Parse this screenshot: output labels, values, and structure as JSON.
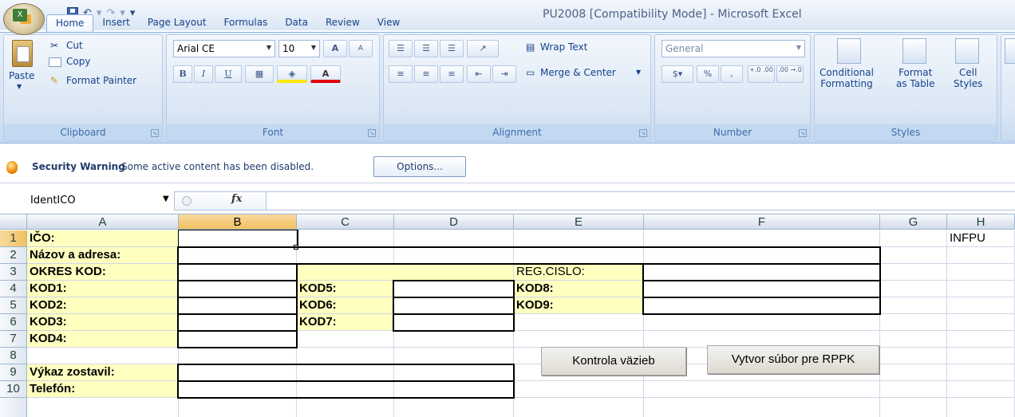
{
  "window": {
    "title": "PU2008  [Compatibility Mode] - Microsoft Excel"
  },
  "quick_access": {
    "undo": "↶",
    "redo": "↷",
    "more": "▾"
  },
  "tabs": [
    "Home",
    "Insert",
    "Page Layout",
    "Formulas",
    "Data",
    "Review",
    "View"
  ],
  "ribbon": {
    "clipboard": {
      "label": "Clipboard",
      "paste": "Paste",
      "cut": "Cut",
      "copy": "Copy",
      "format_painter": "Format Painter"
    },
    "font": {
      "label": "Font",
      "font_name": "Arial CE",
      "font_size": "10",
      "bold": "B",
      "italic": "I",
      "underline": "U",
      "grow": "A",
      "shrink": "A"
    },
    "alignment": {
      "label": "Alignment",
      "wrap_text": "Wrap Text",
      "merge_center": "Merge & Center"
    },
    "number": {
      "label": "Number",
      "format": "General",
      "percent": "%",
      "comma": ",",
      "inc_decimal": "+.0 .00",
      "dec_decimal": ".00 →.0"
    },
    "styles": {
      "label": "Styles",
      "conditional": "Conditional\nFormatting",
      "format_table": "Format\nas Table",
      "cell_styles": "Cell\nStyles"
    }
  },
  "security": {
    "title": "Security Warning",
    "message": "Some active content has been disabled.",
    "options_button": "Options..."
  },
  "formula_bar": {
    "name_box": "IdentICO",
    "fx": "fx",
    "value": ""
  },
  "sheet": {
    "columns": [
      "A",
      "B",
      "C",
      "D",
      "E",
      "F",
      "G",
      "H"
    ],
    "rows": [
      "1",
      "2",
      "3",
      "4",
      "5",
      "6",
      "7",
      "8",
      "9",
      "10"
    ],
    "labels": {
      "a1": "IČO:",
      "a2": "Názov a adresa:",
      "a3": "OKRES KOD:",
      "a4": "KOD1:",
      "a5": "KOD2:",
      "a6": "KOD3:",
      "a7": "KOD4:",
      "a9": "Výkaz zostavil:",
      "a10": "Telefón:",
      "c4": "KOD5:",
      "c5": "KOD6:",
      "c6": "KOD7:",
      "e3": "REG.CISLO:",
      "e4": "KOD8:",
      "e5": "KOD9:",
      "h1": "INFPU"
    },
    "buttons": {
      "check": "Kontrola väzieb",
      "create": "Vytvor súbor pre RPPK"
    }
  }
}
